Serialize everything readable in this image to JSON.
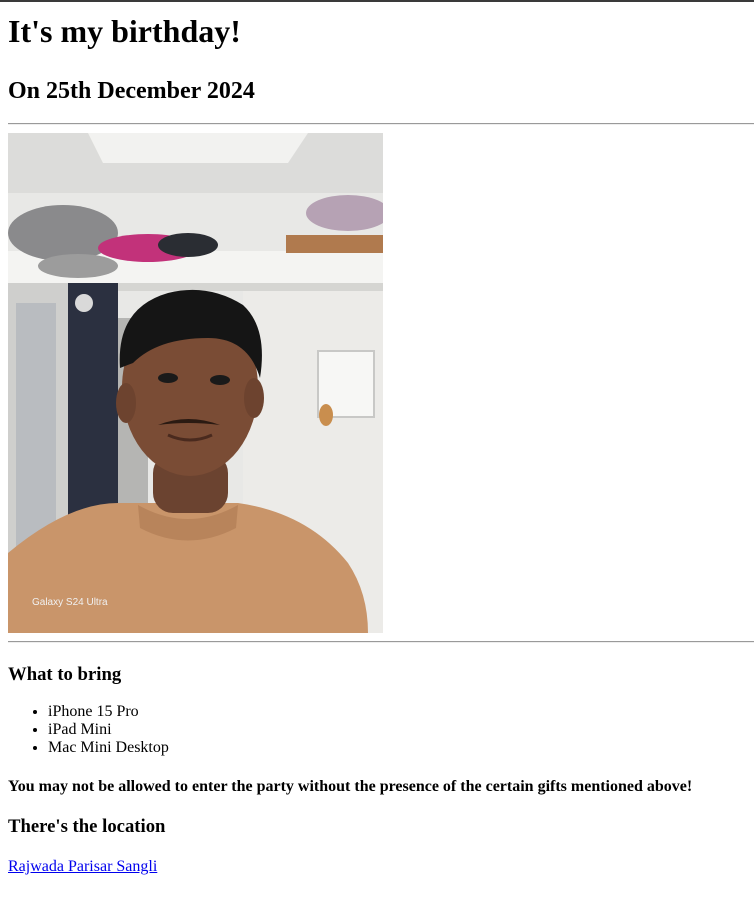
{
  "header": {
    "title": "It's my birthday!",
    "date": "On 25th December 2024"
  },
  "photo": {
    "watermark": "Galaxy S24 Ultra",
    "alt_subject": "selfie-photo"
  },
  "bring": {
    "heading": "What to bring",
    "items": [
      "iPhone 15 Pro",
      "iPad Mini",
      "Mac Mini Desktop"
    ]
  },
  "warning": "You may not be allowed to enter the party without the presence of the certain gifts mentioned above!",
  "location": {
    "heading": "There's the location",
    "link_label": "Rajwada Parisar Sangli"
  },
  "colors": {
    "link": "#0000ee",
    "shirt": "#c9956a",
    "wall": "#e9e9e7"
  }
}
